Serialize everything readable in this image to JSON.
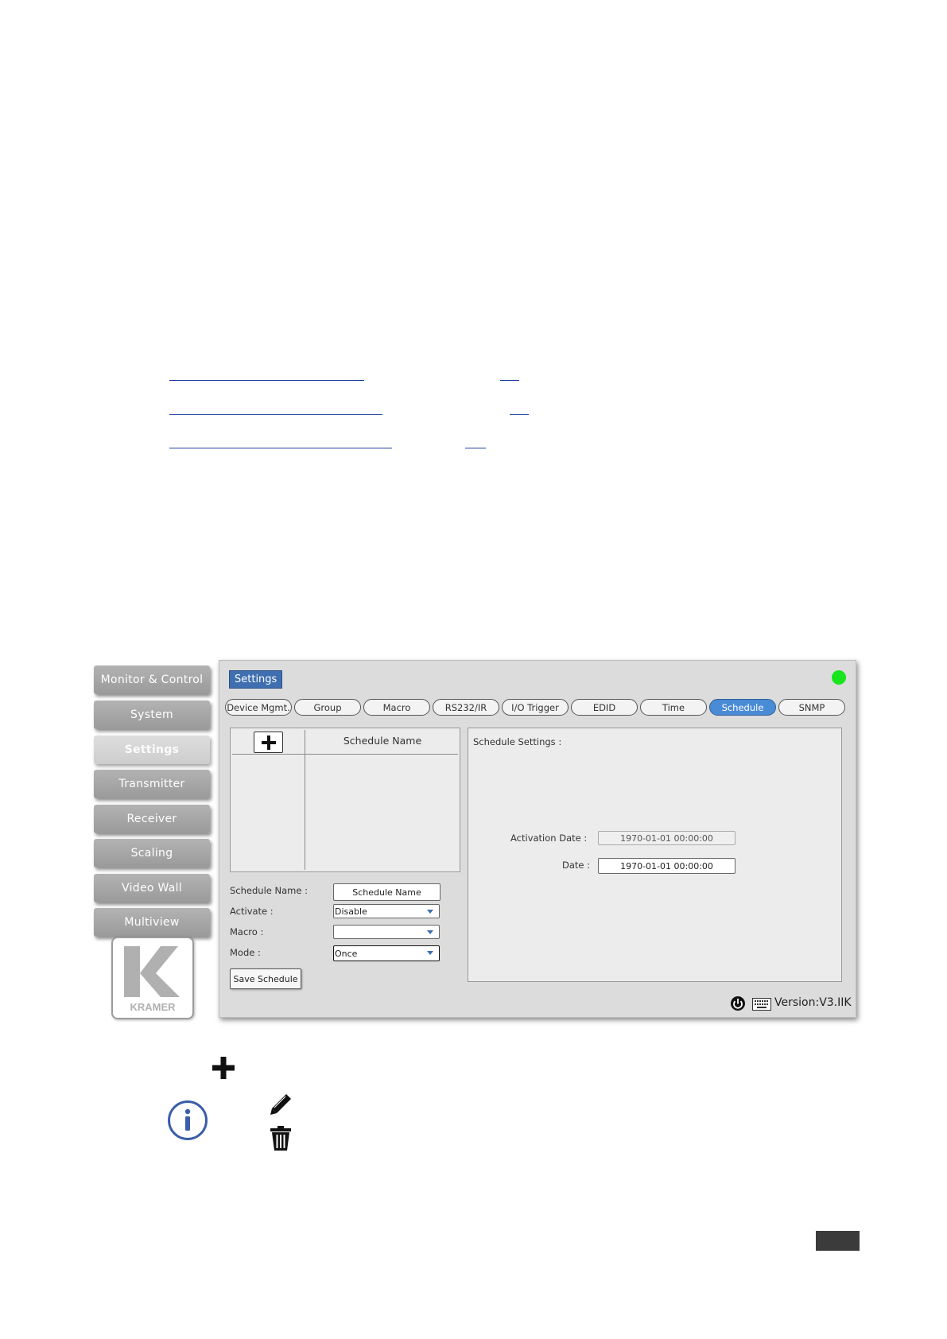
{
  "sidebar": {
    "items": [
      {
        "label": "Monitor & Control"
      },
      {
        "label": "System"
      },
      {
        "label": "Settings"
      },
      {
        "label": "Transmitter"
      },
      {
        "label": "Receiver"
      },
      {
        "label": "Scaling"
      },
      {
        "label": "Video Wall"
      },
      {
        "label": "Multiview"
      }
    ],
    "logo_text": "KRAMER"
  },
  "panel": {
    "title": "Settings",
    "tabs": [
      {
        "label": "Device Mgmt."
      },
      {
        "label": "Group"
      },
      {
        "label": "Macro"
      },
      {
        "label": "RS232/IR"
      },
      {
        "label": "I/O Trigger"
      },
      {
        "label": "EDID"
      },
      {
        "label": "Time"
      },
      {
        "label": "Schedule"
      },
      {
        "label": "SNMP"
      }
    ],
    "active_tab": "Schedule",
    "list": {
      "column_header": "Schedule Name"
    },
    "form": {
      "schedule_name_label": "Schedule Name :",
      "schedule_name_value": "Schedule Name",
      "activate_label": "Activate :",
      "activate_value": "Disable",
      "macro_label": "Macro :",
      "macro_value": "",
      "mode_label": "Mode :",
      "mode_value": "Once",
      "save_label": "Save Schedule"
    },
    "settings": {
      "title": "Schedule Settings :",
      "activation_date_label": "Activation Date :",
      "activation_date_value": "1970-01-01 00:00:00",
      "date_label": "Date :",
      "date_value": "1970-01-01 00:00:00"
    },
    "footer": {
      "version": "Version:V3.IIK"
    },
    "colors": {
      "accent": "#4a8bd6",
      "status": "#18e51c"
    }
  },
  "icons": [
    "plus-icon",
    "info-icon",
    "pencil-icon",
    "trash-icon",
    "power-icon",
    "keyboard-icon"
  ]
}
